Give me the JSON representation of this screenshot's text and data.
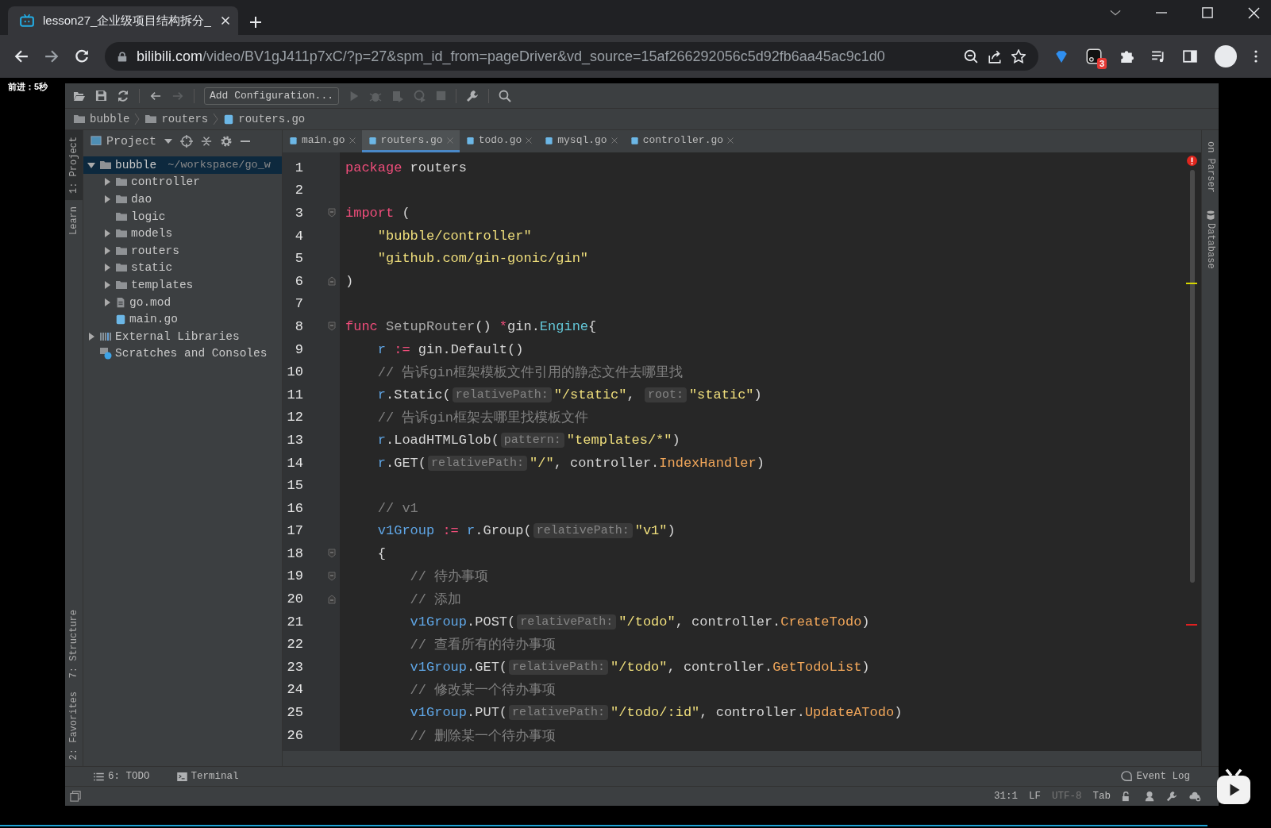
{
  "browser": {
    "tab": {
      "title": "lesson27_企业级项目结构拆分_",
      "selected": true
    },
    "url": {
      "host": "bilibili.com",
      "path": "/video/BV1gJ411p7xC/?p=27&spm_id_from=pageDriver&vd_source=15af266292056c5d92fb6aa45ac9c1d0"
    },
    "extension_badge": "3"
  },
  "video": {
    "seek_hint": "前进：5秒",
    "progress": {
      "level": 0.95
    }
  },
  "ide": {
    "toolbar": {
      "run_config": "Add Configuration..."
    },
    "breadcrumb": [
      {
        "label": "bubble",
        "kind": "folder"
      },
      {
        "label": "routers",
        "kind": "folder"
      },
      {
        "label": "routers.go",
        "kind": "gofile"
      }
    ],
    "left_stripe_top": [
      {
        "label": "1: Project",
        "selected": true
      },
      {
        "label": "Learn",
        "selected": false
      }
    ],
    "left_stripe_bottom": [
      {
        "label": "7: Structure",
        "selected": false
      },
      {
        "label": "2: Favorites",
        "selected": false
      }
    ],
    "project_panel": {
      "title": "Project",
      "tree": [
        {
          "name": "bubble",
          "kind": "folder",
          "path": "~/workspace/go_w",
          "expanded": true,
          "selected": true,
          "children": [
            {
              "name": "controller",
              "kind": "folder",
              "expanded": false,
              "selected": false
            },
            {
              "name": "dao",
              "kind": "folder",
              "expanded": false,
              "selected": false
            },
            {
              "name": "logic",
              "kind": "folder",
              "selected": false
            },
            {
              "name": "models",
              "kind": "folder",
              "expanded": false,
              "selected": false
            },
            {
              "name": "routers",
              "kind": "folder",
              "expanded": false,
              "selected": false
            },
            {
              "name": "static",
              "kind": "folder",
              "expanded": false,
              "selected": false
            },
            {
              "name": "templates",
              "kind": "folder",
              "expanded": false,
              "selected": false
            },
            {
              "name": "go.mod",
              "kind": "file",
              "expanded": false,
              "selected": false
            },
            {
              "name": "main.go",
              "kind": "gofile",
              "selected": false
            }
          ]
        },
        {
          "name": "External Libraries",
          "kind": "libraries",
          "expanded": false,
          "selected": false
        },
        {
          "name": "Scratches and Consoles",
          "kind": "scratches",
          "selected": false
        }
      ]
    },
    "editor_tabs": [
      {
        "label": "main.go",
        "selected": false
      },
      {
        "label": "routers.go",
        "selected": true
      },
      {
        "label": "todo.go",
        "selected": false
      },
      {
        "label": "mysql.go",
        "selected": false
      },
      {
        "label": "controller.go",
        "selected": false
      }
    ],
    "code_lines": [
      {
        "number": "1",
        "tokens": [
          {
            "kind": "kw",
            "text": "package"
          },
          {
            "kind": "plain",
            "text": " routers"
          }
        ]
      },
      {
        "number": "2"
      },
      {
        "number": "3",
        "kind": "fold-start",
        "tokens": [
          {
            "kind": "kw",
            "text": "import"
          },
          {
            "kind": "plain",
            "text": " ("
          }
        ]
      },
      {
        "number": "4",
        "tokens": [
          {
            "kind": "str",
            "text": "    \"bubble/controller\""
          }
        ]
      },
      {
        "number": "5",
        "tokens": [
          {
            "kind": "str",
            "text": "    \"github.com/gin-gonic/gin\""
          }
        ]
      },
      {
        "number": "6",
        "kind": "fold-end",
        "tokens": [
          {
            "kind": "plain",
            "text": ")"
          }
        ]
      },
      {
        "number": "7"
      },
      {
        "number": "8",
        "kind": "fold-start",
        "tokens": [
          {
            "kind": "kw",
            "text": "func"
          },
          {
            "kind": "fndecl",
            "text": " SetupRouter"
          },
          {
            "kind": "plain",
            "text": "() "
          },
          {
            "kind": "op",
            "text": "*"
          },
          {
            "kind": "plain",
            "text": "gin."
          },
          {
            "kind": "type",
            "text": "Engine"
          },
          {
            "kind": "plain",
            "text": "{"
          }
        ]
      },
      {
        "number": "9",
        "tokens": [
          {
            "kind": "var",
            "text": "    r"
          },
          {
            "kind": "op",
            "text": " := "
          },
          {
            "kind": "plain",
            "text": "gin.Default()"
          }
        ]
      },
      {
        "number": "10",
        "tokens": [
          {
            "kind": "com",
            "text": "    // 告诉gin框架模板文件引用的静态文件去哪里找"
          }
        ]
      },
      {
        "number": "11",
        "tokens": [
          {
            "kind": "var",
            "text": "    r"
          },
          {
            "kind": "plain",
            "text": ".Static("
          },
          {
            "kind": "hint",
            "text": "relativePath:"
          },
          {
            "kind": "str",
            "text": "\"/static\""
          },
          {
            "kind": "plain",
            "text": ", "
          },
          {
            "kind": "hint",
            "text": "root:"
          },
          {
            "kind": "str",
            "text": "\"static\""
          },
          {
            "kind": "plain",
            "text": ")"
          }
        ]
      },
      {
        "number": "12",
        "tokens": [
          {
            "kind": "com",
            "text": "    // 告诉gin框架去哪里找模板文件"
          }
        ]
      },
      {
        "number": "13",
        "tokens": [
          {
            "kind": "var",
            "text": "    r"
          },
          {
            "kind": "plain",
            "text": ".LoadHTMLGlob("
          },
          {
            "kind": "hint",
            "text": "pattern:"
          },
          {
            "kind": "str",
            "text": "\"templates/*\""
          },
          {
            "kind": "plain",
            "text": ")"
          }
        ]
      },
      {
        "number": "14",
        "tokens": [
          {
            "kind": "var",
            "text": "    r"
          },
          {
            "kind": "plain",
            "text": ".GET("
          },
          {
            "kind": "hint",
            "text": "relativePath:"
          },
          {
            "kind": "str",
            "text": "\"/\""
          },
          {
            "kind": "plain",
            "text": ", controller."
          },
          {
            "kind": "fn",
            "text": "IndexHandler"
          },
          {
            "kind": "plain",
            "text": ")"
          }
        ]
      },
      {
        "number": "15"
      },
      {
        "number": "16",
        "tokens": [
          {
            "kind": "com",
            "text": "    // v1"
          }
        ]
      },
      {
        "number": "17",
        "tokens": [
          {
            "kind": "var",
            "text": "    v1Group"
          },
          {
            "kind": "op",
            "text": " := "
          },
          {
            "kind": "var",
            "text": "r"
          },
          {
            "kind": "plain",
            "text": ".Group("
          },
          {
            "kind": "hint",
            "text": "relativePath:"
          },
          {
            "kind": "str",
            "text": "\"v1\""
          },
          {
            "kind": "plain",
            "text": ")"
          }
        ]
      },
      {
        "number": "18",
        "kind": "fold-start",
        "tokens": [
          {
            "kind": "plain",
            "text": "    {"
          }
        ]
      },
      {
        "number": "19",
        "kind": "fold-start",
        "tokens": [
          {
            "kind": "com",
            "text": "        // 待办事项"
          }
        ]
      },
      {
        "number": "20",
        "kind": "fold-end",
        "tokens": [
          {
            "kind": "com",
            "text": "        // 添加"
          }
        ]
      },
      {
        "number": "21",
        "tokens": [
          {
            "kind": "var",
            "text": "        v1Group"
          },
          {
            "kind": "plain",
            "text": ".POST("
          },
          {
            "kind": "hint",
            "text": "relativePath:"
          },
          {
            "kind": "str",
            "text": "\"/todo\""
          },
          {
            "kind": "plain",
            "text": ", controller."
          },
          {
            "kind": "fn",
            "text": "CreateTodo"
          },
          {
            "kind": "plain",
            "text": ")"
          }
        ]
      },
      {
        "number": "22",
        "tokens": [
          {
            "kind": "com",
            "text": "        // 查看所有的待办事项"
          }
        ]
      },
      {
        "number": "23",
        "tokens": [
          {
            "kind": "var",
            "text": "        v1Group"
          },
          {
            "kind": "plain",
            "text": ".GET("
          },
          {
            "kind": "hint",
            "text": "relativePath:"
          },
          {
            "kind": "str",
            "text": "\"/todo\""
          },
          {
            "kind": "plain",
            "text": ", controller."
          },
          {
            "kind": "fn",
            "text": "GetTodoList"
          },
          {
            "kind": "plain",
            "text": ")"
          }
        ]
      },
      {
        "number": "24",
        "tokens": [
          {
            "kind": "com",
            "text": "        // 修改某一个待办事项"
          }
        ]
      },
      {
        "number": "25",
        "tokens": [
          {
            "kind": "var",
            "text": "        v1Group"
          },
          {
            "kind": "plain",
            "text": ".PUT("
          },
          {
            "kind": "hint",
            "text": "relativePath:"
          },
          {
            "kind": "str",
            "text": "\"/todo/:id\""
          },
          {
            "kind": "plain",
            "text": ", controller."
          },
          {
            "kind": "fn",
            "text": "UpdateATodo"
          },
          {
            "kind": "plain",
            "text": ")"
          }
        ]
      },
      {
        "number": "26",
        "tokens": [
          {
            "kind": "com",
            "text": "        // 删除某一个待办事项"
          }
        ]
      }
    ],
    "right_stripe": [
      "on Parser",
      "Database"
    ],
    "tool_windows": [
      "6: TODO",
      "Terminal"
    ],
    "event_log": "Event Log",
    "status_bar": [
      {
        "text": "31:1",
        "disabled": false
      },
      {
        "text": "LF",
        "disabled": false
      },
      {
        "text": "UTF-8",
        "disabled": true
      },
      {
        "text": "Tab",
        "disabled": false
      }
    ]
  }
}
